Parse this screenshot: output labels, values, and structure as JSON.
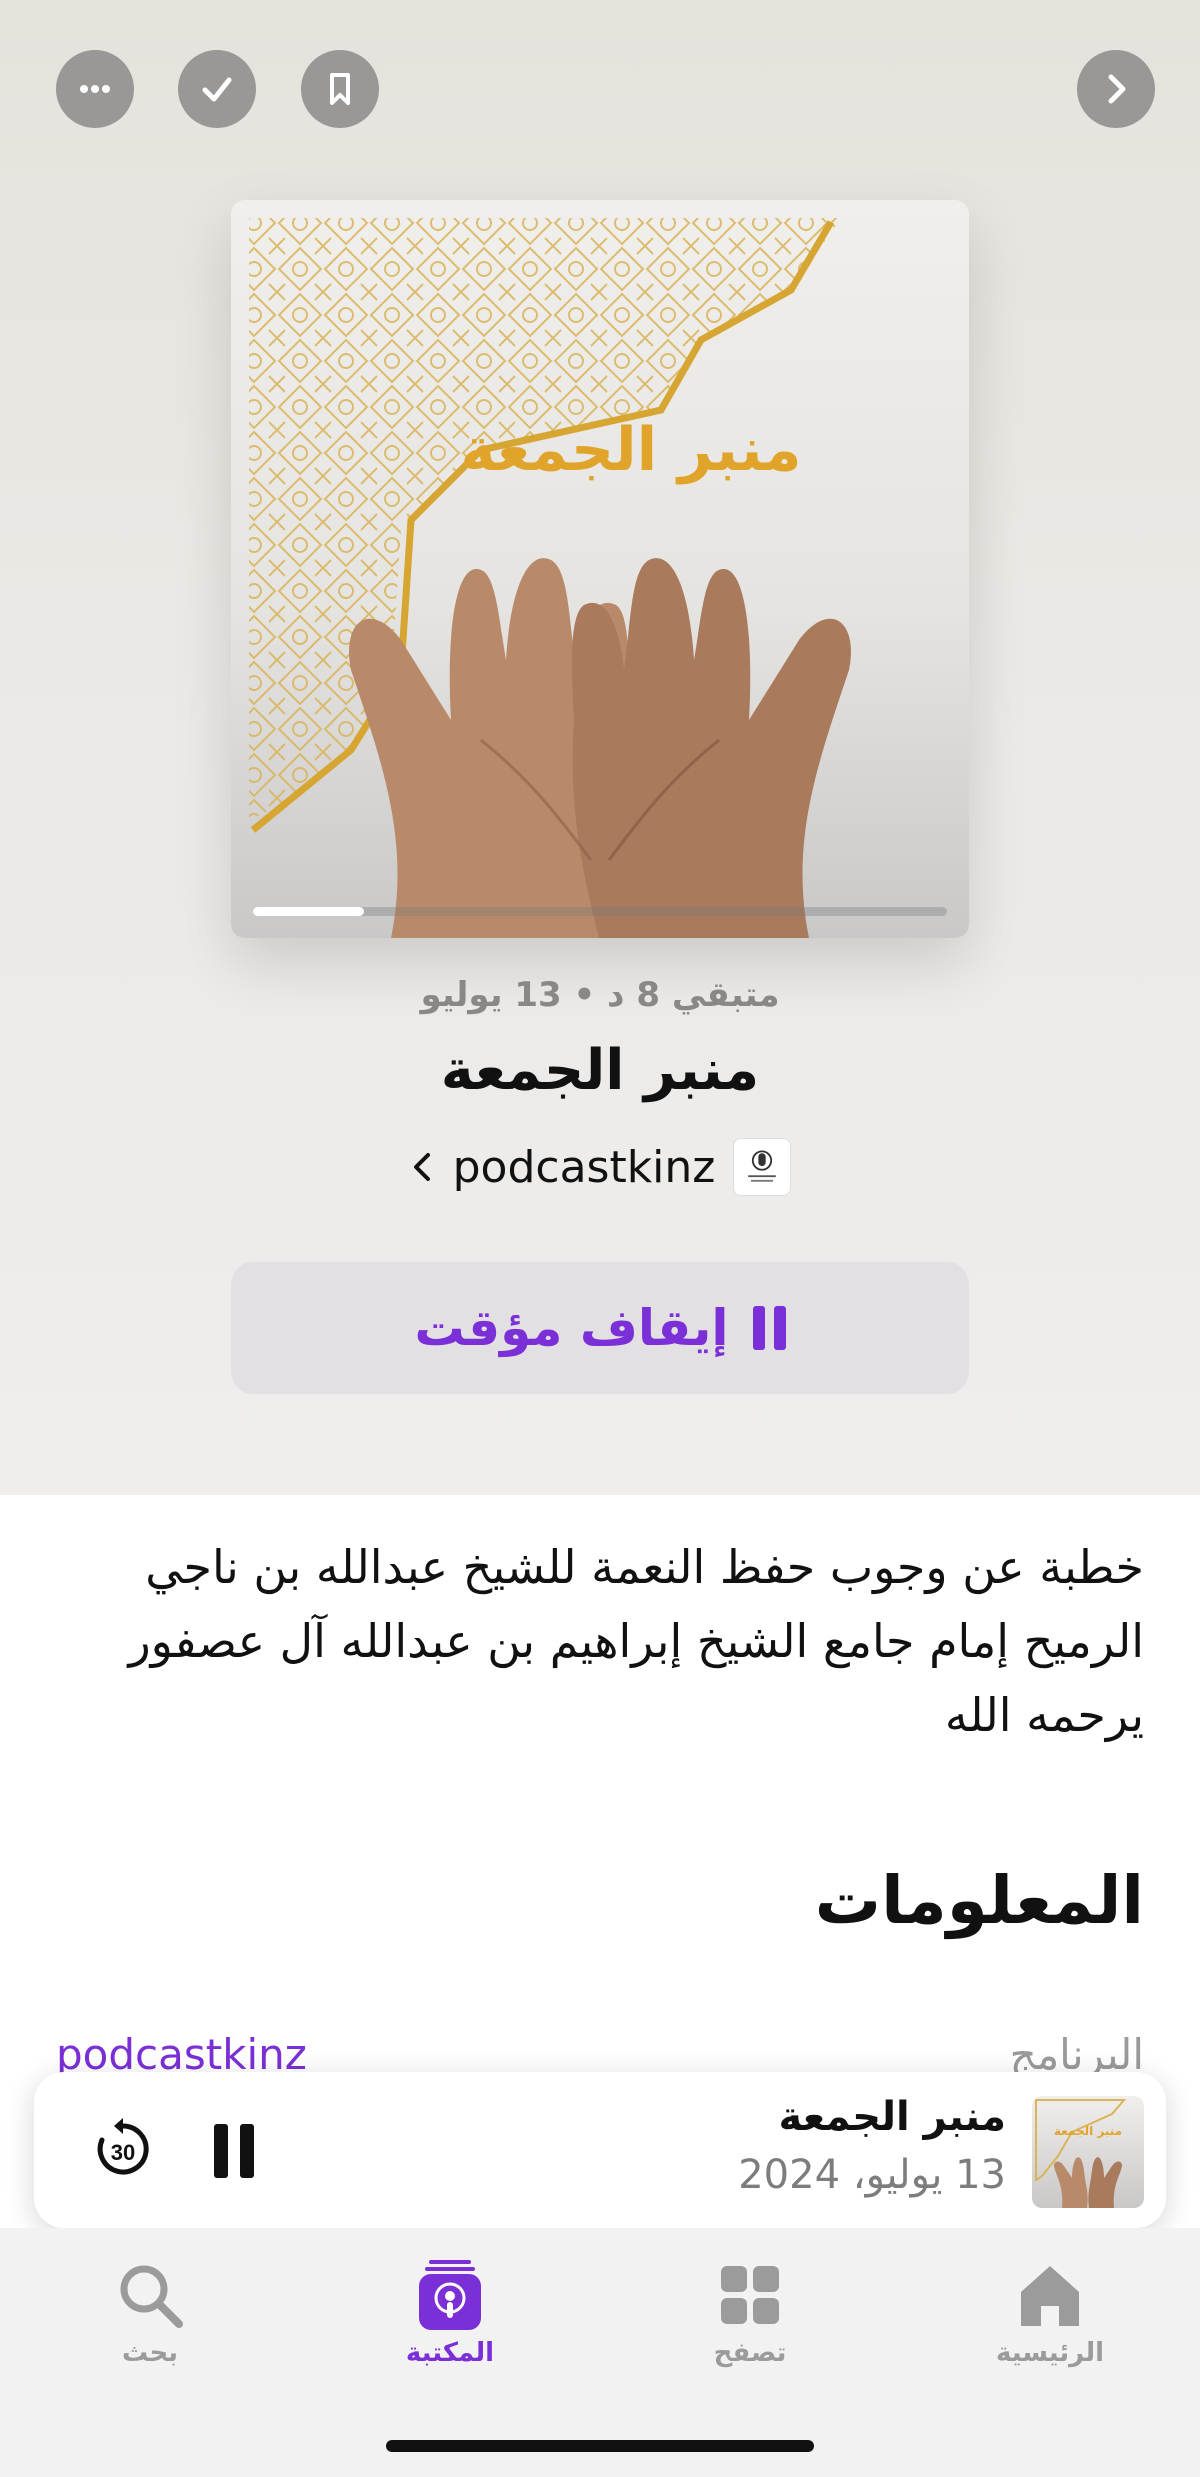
{
  "top_actions": {
    "more_icon": "ellipsis-icon",
    "played_icon": "checkmark-icon",
    "save_icon": "bookmark-icon",
    "next_icon": "chevron-right-icon"
  },
  "artwork": {
    "title": "منبر الجمعة",
    "progress": 0.16
  },
  "episode": {
    "meta": "متبقي 8 د • 13 يوليو",
    "title": "منبر الجمعة",
    "show_name": "podcastkinz",
    "pause_label": "إيقاف مؤقت"
  },
  "description": "خطبة عن وجوب حفظ النعمة للشيخ عبدالله بن ناجي الرميح إمام جامع الشيخ إبراهيم بن عبدالله آل عصفور يرحمه الله",
  "information": {
    "heading": "المعلومات",
    "rows": [
      {
        "key": "البرنامج",
        "value": "podcastkinz"
      }
    ]
  },
  "mini_player": {
    "title": "منبر الجمعة",
    "date": "13 يوليو، 2024",
    "skip_back_seconds": "30"
  },
  "tabs": [
    {
      "label": "الرئيسية",
      "icon": "house-icon"
    },
    {
      "label": "تصفح",
      "icon": "grid-icon"
    },
    {
      "label": "المكتبة",
      "icon": "podcasts-icon"
    },
    {
      "label": "بحث",
      "icon": "search-icon"
    }
  ],
  "colors": {
    "accent": "#7b2fd6",
    "art_title": "#e1a42b"
  }
}
